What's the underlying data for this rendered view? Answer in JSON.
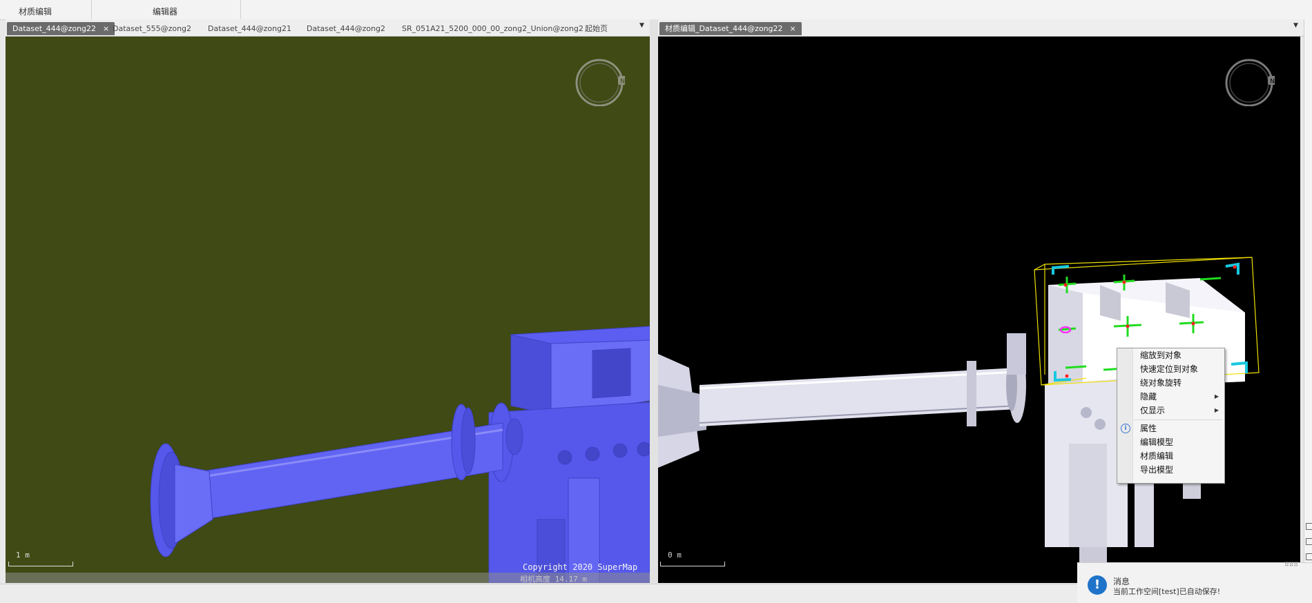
{
  "ribbon": {
    "groups": [
      {
        "label": "材质编辑"
      },
      {
        "label": "编辑器"
      }
    ]
  },
  "left_panel": {
    "tabs": [
      {
        "label": "Dataset_444@zong22",
        "active": true
      },
      {
        "label": "Dataset_555@zong2"
      },
      {
        "label": "Dataset_444@zong21"
      },
      {
        "label": "Dataset_444@zong2"
      },
      {
        "label": "SR_051A21_5200_000_00_zong2_Union@zong2"
      },
      {
        "label": "起始页"
      }
    ],
    "close_glyph": "×",
    "dropdown_glyph": "▼",
    "background": "#3f4a14",
    "model_color": "#5b5ef0",
    "scale_label": "1 m",
    "copyright": "Copyright 2020 SuperMap",
    "camera_height": "相机高度 14.17 m"
  },
  "right_panel": {
    "tabs": [
      {
        "label": "材质编辑_Dataset_444@zong22",
        "active": true
      }
    ],
    "close_glyph": "×",
    "dropdown_glyph": "▼",
    "background": "#000000",
    "scale_label": "0 m"
  },
  "compass": {
    "letter": "N"
  },
  "context_menu": {
    "items": [
      {
        "label": "缩放到对象"
      },
      {
        "label": "快速定位到对象"
      },
      {
        "label": "绕对象旋转"
      },
      {
        "label": "隐藏",
        "submenu": true
      },
      {
        "label": "仅显示",
        "submenu": true
      },
      {
        "label": "属性",
        "icon": "info-icon"
      },
      {
        "label": "编辑模型"
      },
      {
        "label": "材质编辑"
      },
      {
        "label": "导出模型"
      }
    ],
    "submenu_glyph": "▶",
    "info_glyph": "i"
  },
  "notification": {
    "title": "消息",
    "message": "当前工作空间[test]已自动保存!",
    "icon": "exclamation-icon",
    "glyph": "!",
    "grip": "⠿⠿⠿"
  },
  "colors": {
    "accent": "#1f74c9",
    "selection_box": "#f0e000",
    "gizmo_green": "#1fdc1f",
    "gizmo_cyan": "#18c8e0"
  }
}
